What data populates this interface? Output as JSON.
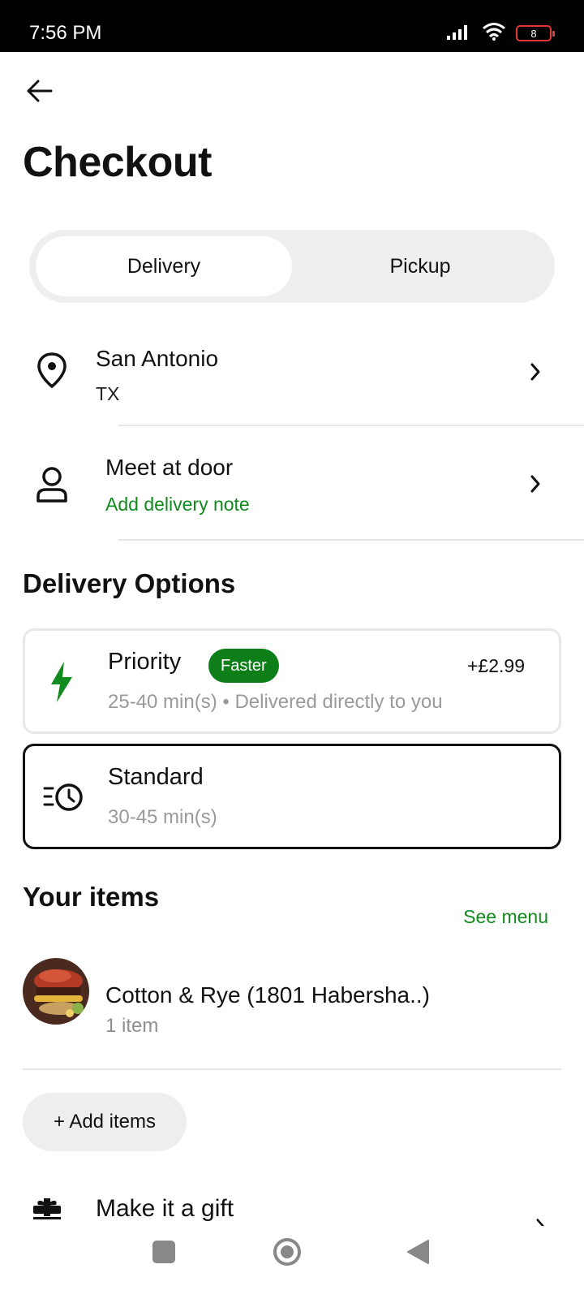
{
  "status_bar": {
    "time": "7:56 PM",
    "battery": "8"
  },
  "header": {
    "title": "Checkout"
  },
  "mode_toggle": {
    "options": [
      "Delivery",
      "Pickup"
    ],
    "selected": "Delivery"
  },
  "address": {
    "city": "San Antonio",
    "state": "TX"
  },
  "dropoff": {
    "title": "Meet at door",
    "action": "Add delivery note"
  },
  "delivery_options": {
    "title": "Delivery Options",
    "options": [
      {
        "name": "Priority",
        "badge": "Faster",
        "price": "+£2.99",
        "detail": "25-40 min(s) • Delivered directly to you",
        "selected": false
      },
      {
        "name": "Standard",
        "detail": "30-45 min(s)",
        "selected": true
      }
    ]
  },
  "items": {
    "title": "Your items",
    "see_menu": "See menu",
    "store": {
      "name": "Cotton & Rye (1801 Habersha..)",
      "count": "1 item"
    },
    "add_items": "+ Add items"
  },
  "gift": {
    "label": "Make it a gift"
  },
  "colors": {
    "accent_green": "#118a1e",
    "badge_green": "#0e7f18",
    "battery_low": "#e53935"
  },
  "icons": [
    "arrow-left-icon",
    "location-pin-icon",
    "person-icon",
    "chevron-right-icon",
    "lightning-icon",
    "clock-fast-icon",
    "gift-icon"
  ]
}
